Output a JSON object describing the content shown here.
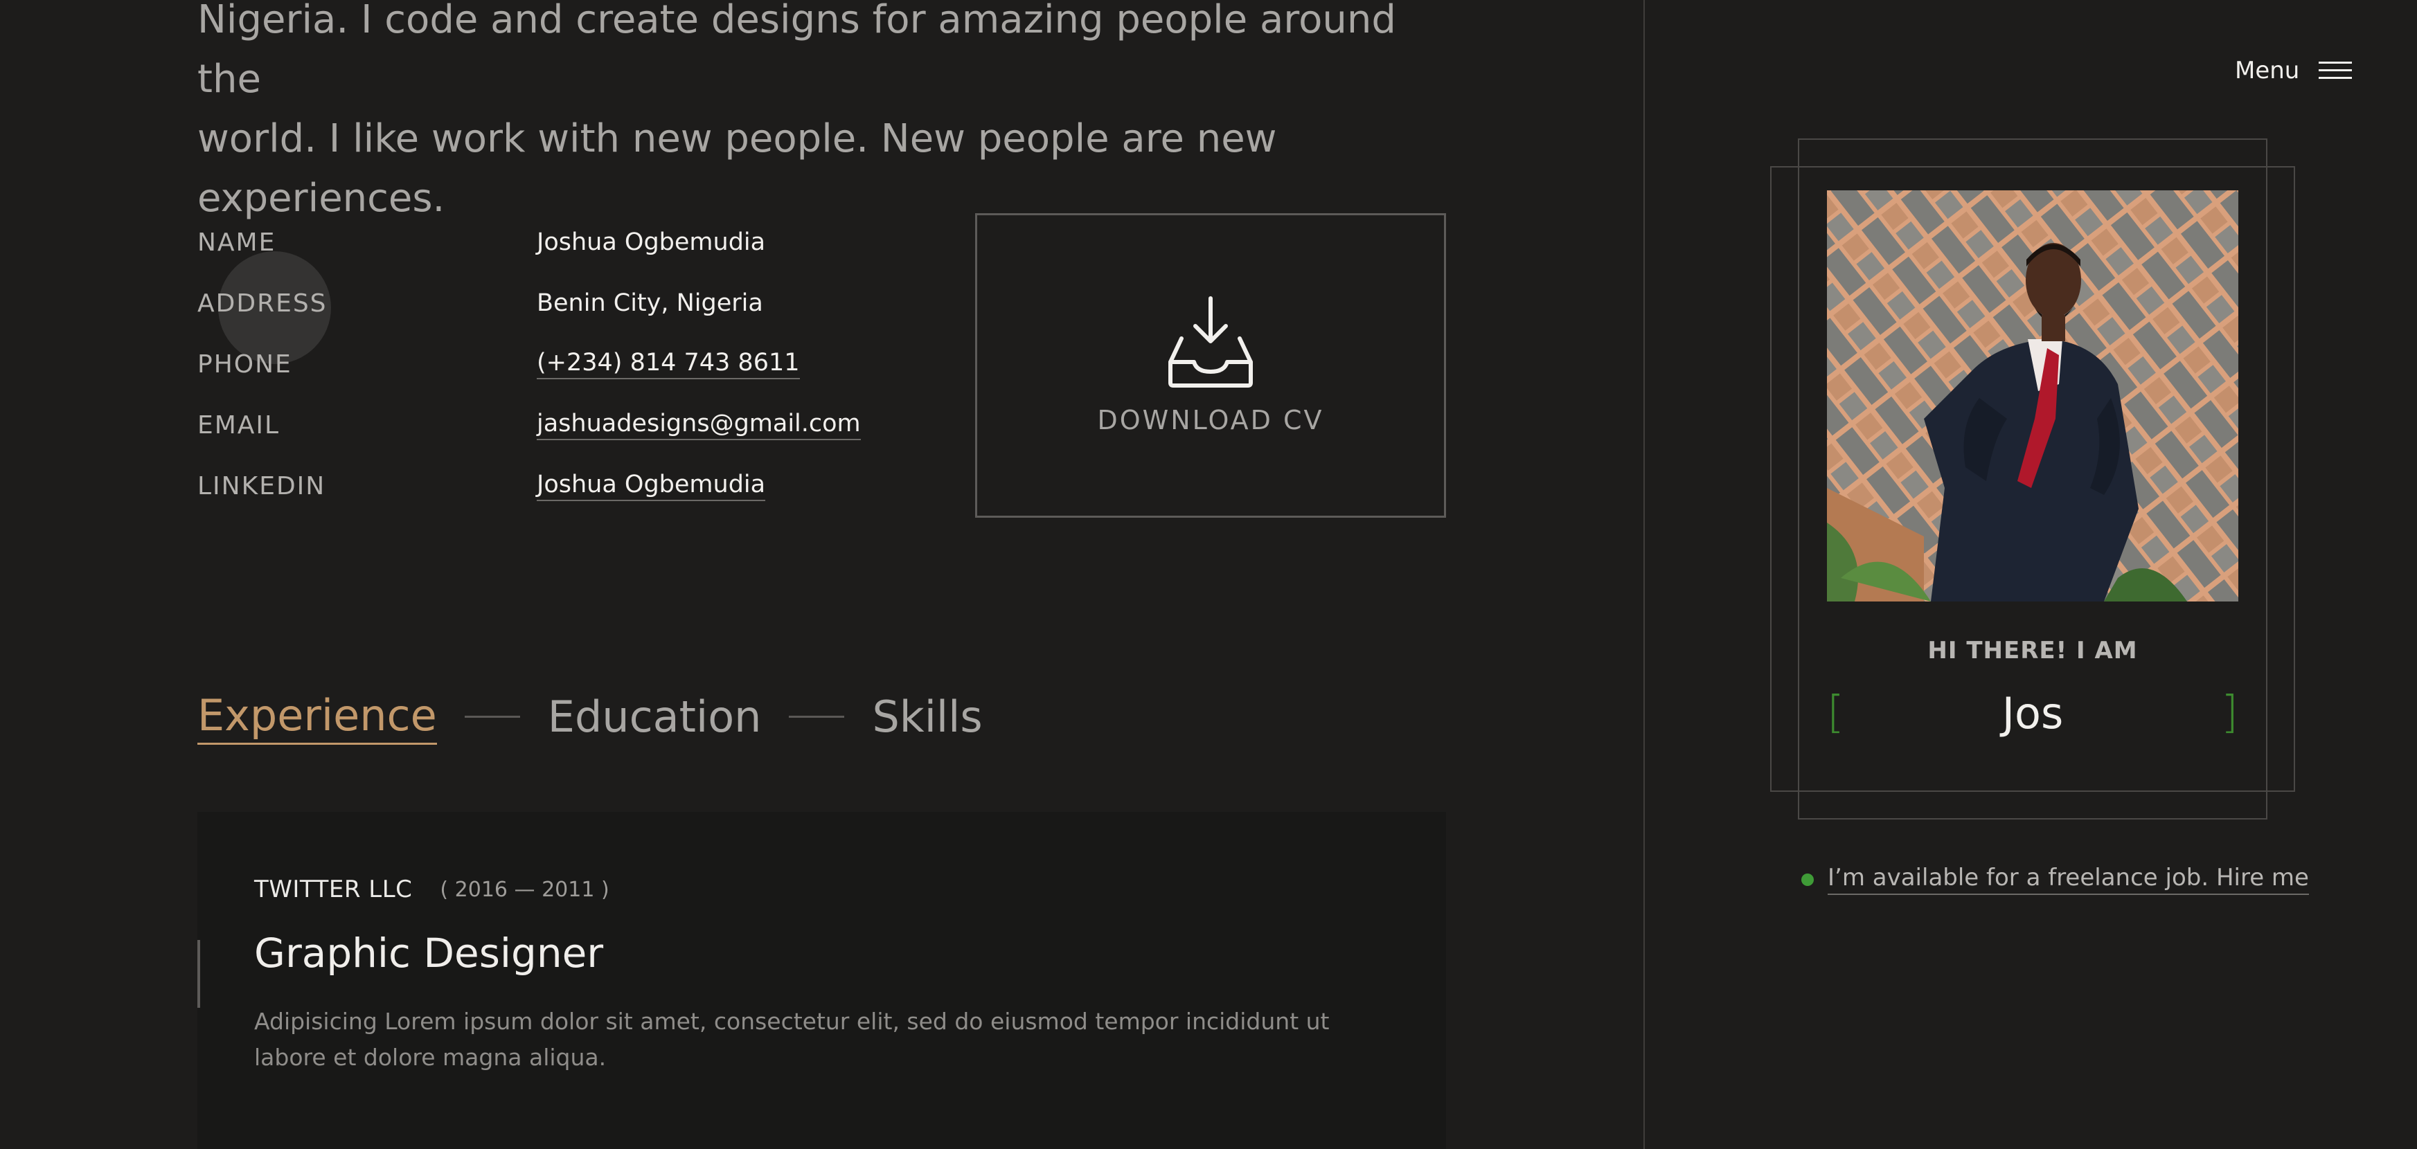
{
  "intro": {
    "line1": "Nigeria. I code and create designs for amazing people around the",
    "line2": "world. I like work with new people. New people are new experiences."
  },
  "info": [
    {
      "label": "NAME",
      "value": "Joshua Ogbemudia"
    },
    {
      "label": "ADDRESS",
      "value": "Benin City, Nigeria"
    },
    {
      "label": "PHONE",
      "value": "(+234) 814 743 8611"
    },
    {
      "label": "EMAIL",
      "value": "jashuadesigns@gmail.com"
    },
    {
      "label": "LINKEDIN",
      "value": "Joshua Ogbemudia"
    }
  ],
  "download": {
    "label": "DOWNLOAD CV",
    "icon": "download-tray-icon"
  },
  "tabs": [
    {
      "label": "Experience",
      "active": true
    },
    {
      "label": "Education",
      "active": false
    },
    {
      "label": "Skills",
      "active": false
    }
  ],
  "experience": {
    "company": "TWITTER LLC",
    "years": "( 2016 — 2011 )",
    "title": "Graphic Designer",
    "description": "Adipisicing Lorem ipsum dolor sit amet, consectetur elit, sed do eiusmod tempor incididunt ut labore et dolore magna aliqua."
  },
  "sidebar": {
    "menu_label": "Menu",
    "greeting": "HI THERE! I AM",
    "typed_name": "Jos",
    "bracket_open": "[",
    "bracket_close": "]",
    "hire_text": "I’m available for a freelance job. Hire me"
  },
  "colors": {
    "background": "#1d1c1b",
    "accent": "#c2986a",
    "green": "#3f9b37"
  }
}
